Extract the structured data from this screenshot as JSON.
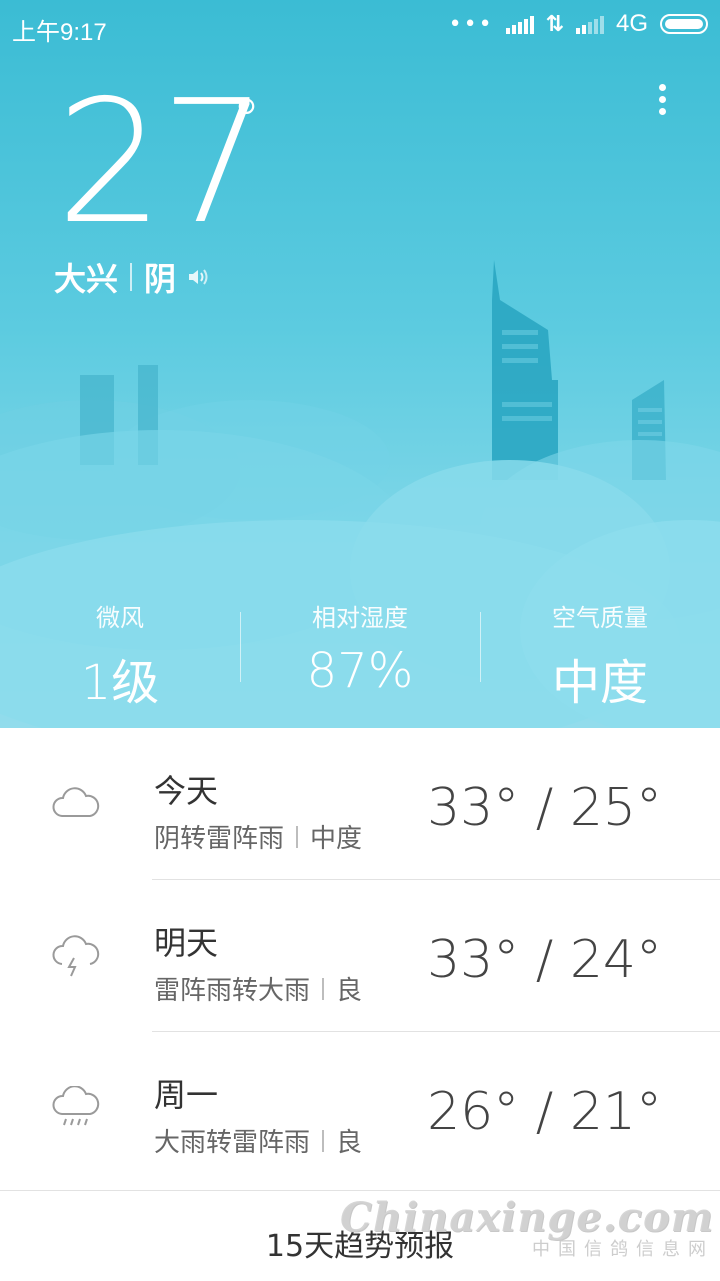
{
  "status_bar": {
    "time": "上午9:17",
    "network": "4G"
  },
  "current": {
    "temperature": "27",
    "degree_symbol": "°",
    "city": "大兴",
    "condition": "阴"
  },
  "stats": [
    {
      "label": "微风",
      "value": "1级"
    },
    {
      "label": "相对湿度",
      "value": "87%"
    },
    {
      "label": "空气质量",
      "value": "中度"
    }
  ],
  "forecast": [
    {
      "day": "今天",
      "condition": "阴转雷阵雨",
      "air": "中度",
      "temps": "33° / 25°",
      "icon": "cloud-icon"
    },
    {
      "day": "明天",
      "condition": "雷阵雨转大雨",
      "air": "良",
      "temps": "33° / 24°",
      "icon": "thunderstorm-icon"
    },
    {
      "day": "周一",
      "condition": "大雨转雷阵雨",
      "air": "良",
      "temps": "26° / 21°",
      "icon": "heavy-rain-icon"
    }
  ],
  "footer": {
    "trend_label": "15天趋势预报"
  },
  "watermark": {
    "main": "Chinaxinge.com",
    "sub": "中国信鸽信息网"
  },
  "colors": {
    "sky_top": "#3bbcd4",
    "sky_bottom": "#92dcec",
    "text_dark": "#333333"
  }
}
